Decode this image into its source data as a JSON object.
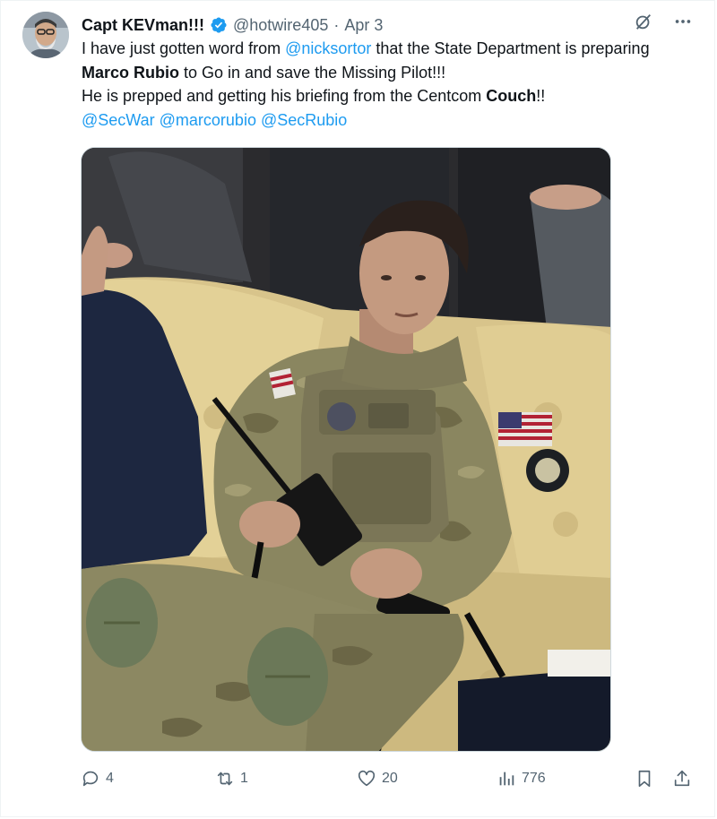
{
  "author": {
    "display_name": "Capt KEVman!!!",
    "handle": "@hotwire405",
    "separator": "·",
    "date": "Apr 3"
  },
  "tweet": {
    "segments": [
      {
        "text": "I have just gotten word from ",
        "style": "plain"
      },
      {
        "text": "@nicksortor",
        "style": "mention"
      },
      {
        "text": " that the State Department is preparing ",
        "style": "plain"
      },
      {
        "text": "Marco Rubio",
        "style": "bold"
      },
      {
        "text": " to Go in and save the Missing Pilot!!!",
        "style": "plain"
      },
      {
        "text": "\n",
        "style": "break"
      },
      {
        "text": "He is prepped and getting his briefing from the Centcom ",
        "style": "plain"
      },
      {
        "text": "Couch",
        "style": "bold"
      },
      {
        "text": "!!",
        "style": "plain"
      },
      {
        "text": "\n",
        "style": "break"
      },
      {
        "text": "@SecWar",
        "style": "mention"
      },
      {
        "text": " ",
        "style": "plain"
      },
      {
        "text": "@marcorubio",
        "style": "mention"
      },
      {
        "text": " ",
        "style": "plain"
      },
      {
        "text": "@SecRubio",
        "style": "mention"
      }
    ]
  },
  "actions": {
    "replies": "4",
    "reposts": "1",
    "likes": "20",
    "views": "776"
  },
  "icons": {
    "verified": "verified-badge-icon",
    "grok": "grok-icon",
    "more": "more-icon",
    "reply": "reply-icon",
    "repost": "repost-icon",
    "like": "heart-icon",
    "views": "views-icon",
    "bookmark": "bookmark-icon",
    "share": "share-icon"
  },
  "colors": {
    "accent": "#1d9bf0",
    "text": "#0f1419",
    "secondary": "#536471"
  }
}
